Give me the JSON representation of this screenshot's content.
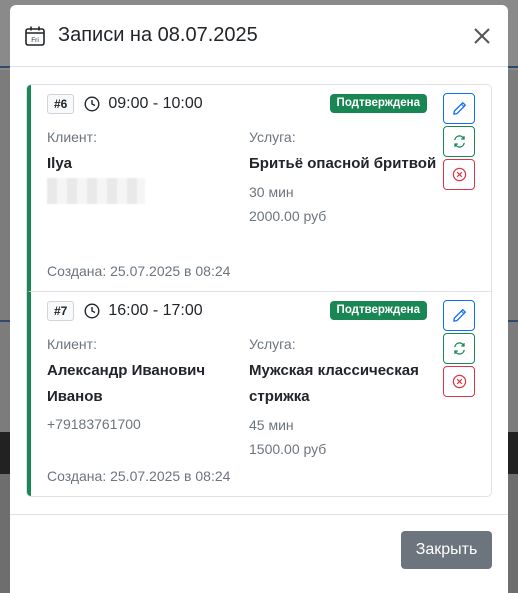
{
  "modal": {
    "title": "Записи на 08.07.2025",
    "calendar_icon_text": "Fri",
    "close_button_label": "Закрыть"
  },
  "labels": {
    "client": "Клиент:",
    "service": "Услуга:"
  },
  "appointments": [
    {
      "number": "#6",
      "time": "09:00 - 10:00",
      "status": "Подтверждена",
      "client_name": "Ilya",
      "client_phone": "",
      "service_name": "Бритьё опасной бритвой",
      "duration": "30 мин",
      "price": "2000.00 руб",
      "created": "Создана: 25.07.2025 в 08:24"
    },
    {
      "number": "#7",
      "time": "16:00 - 17:00",
      "status": "Подтверждена",
      "client_name": "Александр Иванович Иванов",
      "client_phone": "+79183761700",
      "service_name": "Мужская классическая стрижка",
      "duration": "45 мин",
      "price": "1500.00 руб",
      "created": "Создана: 25.07.2025 в 08:24"
    }
  ],
  "colors": {
    "accent_success": "#198754",
    "accent_primary": "#0d6efd",
    "accent_danger": "#dc3545",
    "secondary": "#6c757d"
  }
}
